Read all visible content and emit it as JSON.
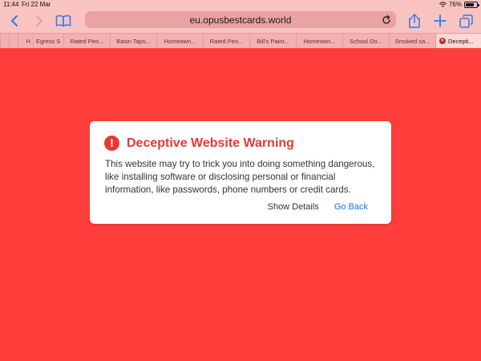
{
  "status_bar": {
    "time": "11:44",
    "date": "Fri 22 Mar",
    "battery_percent_label": "76%",
    "battery_level": 0.76
  },
  "toolbar": {
    "back_icon": "chevron-left-icon",
    "forward_icon": "chevron-right-icon",
    "bookmarks_icon": "book-icon",
    "share_icon": "share-icon",
    "new_tab_icon": "plus-icon",
    "tabs_icon": "tabs-icon"
  },
  "address_bar": {
    "url": "eu.opusbestcards.world",
    "reload_icon": "reload-icon"
  },
  "tabs": [
    {
      "label": "",
      "active": false
    },
    {
      "label": "",
      "active": false
    },
    {
      "label": "H",
      "active": false
    },
    {
      "label": "Egress S",
      "active": false
    },
    {
      "label": "Rated Peo...",
      "active": false
    },
    {
      "label": "Basin Taps...",
      "active": false
    },
    {
      "label": "Homeown...",
      "active": false
    },
    {
      "label": "Rated Peo...",
      "active": false
    },
    {
      "label": "Bill's Paint...",
      "active": false
    },
    {
      "label": "Homeown...",
      "active": false
    },
    {
      "label": "School Do...",
      "active": false
    },
    {
      "label": "Smoked sa...",
      "active": false
    },
    {
      "label": "Decepti...",
      "active": true
    }
  ],
  "warning_dialog": {
    "icon": "exclamation-icon",
    "title": "Deceptive Website Warning",
    "message": "This website may try to trick you into doing something dangerous, like installing software or disclosing personal or financial information, like passwords, phone numbers or credit cards.",
    "show_details_label": "Show Details",
    "go_back_label": "Go Back"
  },
  "colors": {
    "page_background": "#ff3d3a",
    "chrome_background": "#f8c3c1",
    "warning_red": "#e53935",
    "link_blue": "#1a73e8",
    "toolbar_icon": "#2f7be5"
  }
}
